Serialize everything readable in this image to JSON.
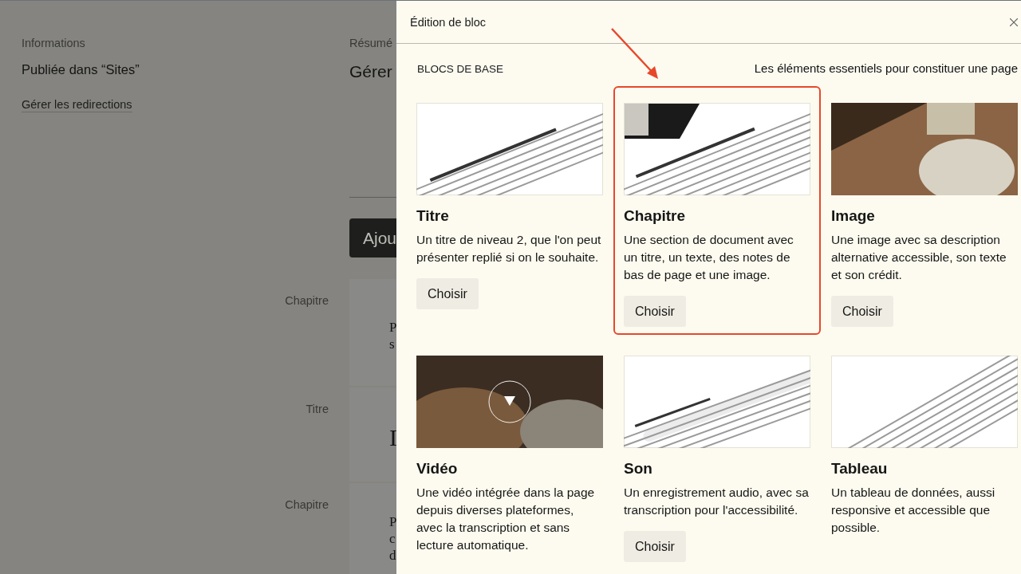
{
  "page": {
    "info_label": "Informations",
    "published": "Publiée dans “Sites”",
    "redirects_link": "Gérer les redirections",
    "summary_label": "Résumé",
    "summary_title": "Gérer",
    "add_button": "Ajou",
    "blocks": [
      {
        "label": "Chapitre",
        "lines": [
          "P",
          "s"
        ]
      },
      {
        "label": "Titre",
        "lines": [
          "I"
        ]
      },
      {
        "label": "Chapitre",
        "lines": [
          "P",
          "c",
          "d"
        ]
      }
    ]
  },
  "dialog": {
    "title": "Édition de bloc",
    "section": "BLOCS DE BASE",
    "section_hint": "Les éléments essentiels pour constituer une page",
    "blocks": [
      {
        "kind": "heading-doc",
        "title": "Titre",
        "description": "Un titre de niveau 2, que l'on peut présenter replié si on le souhaite.",
        "button": "Choisir",
        "selected": false
      },
      {
        "kind": "chapter-doc",
        "title": "Chapitre",
        "description": "Une section de document avec un titre, un texte, des notes de bas de page et une image.",
        "button": "Choisir",
        "selected": true
      },
      {
        "kind": "photo",
        "title": "Image",
        "description": "Une image avec sa description alternative accessible, son texte et son crédit.",
        "button": "Choisir",
        "selected": false
      },
      {
        "kind": "video",
        "title": "Vidéo",
        "description": "Une vidéo intégrée dans la page depuis diverses plateformes, avec la transcription et sans lecture automatique.",
        "selected": false
      },
      {
        "kind": "audio-doc",
        "title": "Son",
        "description": "Un enregistrement audio, avec sa transcription pour l'accessibilité.",
        "button": "Choisir",
        "selected": false
      },
      {
        "kind": "table-doc",
        "title": "Tableau",
        "description": "Un tableau de données, aussi responsive et accessible que possible.",
        "selected": false
      }
    ]
  }
}
